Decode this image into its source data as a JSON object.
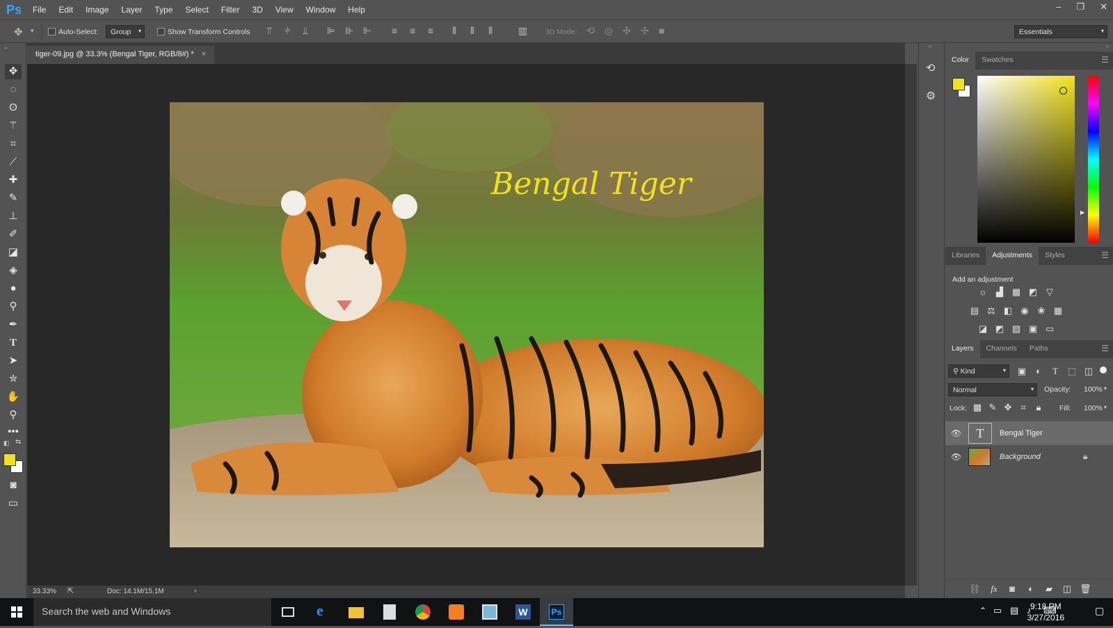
{
  "app": {
    "logo": "Ps",
    "menus": [
      "File",
      "Edit",
      "Image",
      "Layer",
      "Type",
      "Select",
      "Filter",
      "3D",
      "View",
      "Window",
      "Help"
    ],
    "window_controls": [
      "–",
      "❐",
      "✕"
    ]
  },
  "options": {
    "auto_select_label": "Auto-Select:",
    "auto_select_value": "Group",
    "show_transform_label": "Show Transform Controls",
    "mode_3d_label": "3D Mode:",
    "workspace": "Essentials"
  },
  "document": {
    "tab_title": "tiger-09.jpg @ 33.3% (Bengal Tiger, RGB/8#) *",
    "close": "×",
    "overlay_text": "Bengal Tiger",
    "zoom": "33.33%",
    "doc_size": "Doc: 14.1M/15.1M"
  },
  "colors": {
    "foreground": "#f2e21c",
    "background": "#ffffff",
    "accent": "#31a8ff"
  },
  "color_panel": {
    "tabs": [
      "Color",
      "Swatches"
    ],
    "active": 0
  },
  "adjust_panel": {
    "tabs": [
      "Libraries",
      "Adjustments",
      "Styles"
    ],
    "active": 1,
    "heading": "Add an adjustment"
  },
  "layers_panel": {
    "tabs": [
      "Layers",
      "Channels",
      "Paths"
    ],
    "active": 0,
    "filter_kind": "Kind",
    "blend_mode": "Normal",
    "opacity_label": "Opacity:",
    "opacity": "100%",
    "lock_label": "Lock:",
    "fill_label": "Fill:",
    "fill": "100%",
    "layers": [
      {
        "name": "Bengal Tiger",
        "type": "text",
        "selected": true
      },
      {
        "name": "Background",
        "type": "image",
        "locked": true
      }
    ]
  },
  "taskbar": {
    "search_placeholder": "Search the web and Windows",
    "time": "9:18 PM",
    "date": "3/27/2016"
  }
}
